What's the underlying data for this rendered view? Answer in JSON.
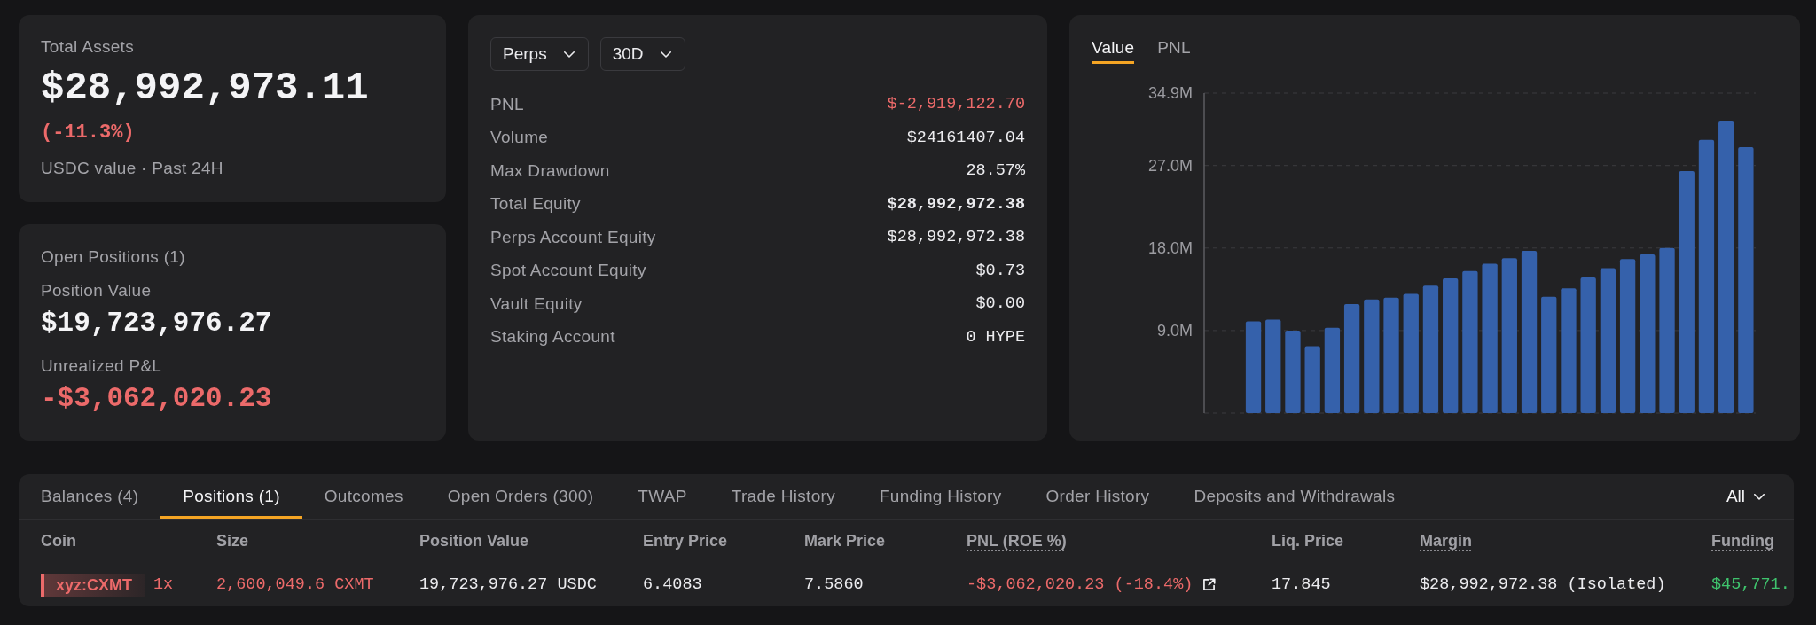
{
  "total_assets": {
    "label": "Total Assets",
    "value": "$28,992,973.11",
    "change": "(-11.3%)",
    "change_negative": true,
    "note": "USDC value · Past 24H"
  },
  "open_positions": {
    "title": "Open Positions (1)",
    "position_value_label": "Position Value",
    "position_value": "$19,723,976.27",
    "unrealized_pnl_label": "Unrealized P&L",
    "unrealized_pnl": "-$3,062,020.23",
    "unrealized_pnl_negative": true
  },
  "summary": {
    "filters": [
      {
        "label": "Perps"
      },
      {
        "label": "30D"
      }
    ],
    "rows": [
      {
        "label": "PNL",
        "value": "$-2,919,122.70",
        "negative": true,
        "bold": false
      },
      {
        "label": "Volume",
        "value": "$24161407.04",
        "negative": false,
        "bold": false
      },
      {
        "label": "Max Drawdown",
        "value": "28.57%",
        "negative": false,
        "bold": false
      },
      {
        "label": "Total Equity",
        "value": "$28,992,972.38",
        "negative": false,
        "bold": true
      },
      {
        "label": "Perps Account Equity",
        "value": "$28,992,972.38",
        "negative": false,
        "bold": false
      },
      {
        "label": "Spot Account Equity",
        "value": "$0.73",
        "negative": false,
        "bold": false
      },
      {
        "label": "Vault Equity",
        "value": "$0.00",
        "negative": false,
        "bold": false
      },
      {
        "label": "Staking Account",
        "value": "0 HYPE",
        "negative": false,
        "bold": false
      }
    ]
  },
  "chart": {
    "tabs": [
      {
        "label": "Value",
        "selected": true
      },
      {
        "label": "PNL",
        "selected": false
      }
    ],
    "chart_data": {
      "type": "bar",
      "grid": true,
      "ylim": [
        0,
        34.9
      ],
      "yticks": [
        {
          "value": 9,
          "label": "9.0M"
        },
        {
          "value": 18,
          "label": "18.0M"
        },
        {
          "value": 27,
          "label": "27.0M"
        },
        {
          "value": 34.9,
          "label": "34.9M"
        }
      ],
      "values": [
        null,
        null,
        10.0,
        10.2,
        9.0,
        7.3,
        9.3,
        11.9,
        12.4,
        12.6,
        13.0,
        13.9,
        14.7,
        15.5,
        16.3,
        16.9,
        17.7,
        12.7,
        13.6,
        14.8,
        15.8,
        16.8,
        17.3,
        18.0,
        26.4,
        29.8,
        31.8,
        29.0
      ]
    }
  },
  "positions": {
    "tabs": [
      {
        "label": "Balances (4)",
        "selected": false
      },
      {
        "label": "Positions (1)",
        "selected": true
      },
      {
        "label": "Outcomes",
        "selected": false
      },
      {
        "label": "Open Orders (300)",
        "selected": false
      },
      {
        "label": "TWAP",
        "selected": false
      },
      {
        "label": "Trade History",
        "selected": false
      },
      {
        "label": "Funding History",
        "selected": false
      },
      {
        "label": "Order History",
        "selected": false
      },
      {
        "label": "Deposits and Withdrawals",
        "selected": false
      }
    ],
    "filter": {
      "label": "All"
    },
    "columns": [
      {
        "label": "Coin",
        "kind": "coin",
        "underlined": false
      },
      {
        "label": "Size",
        "kind": "text",
        "underlined": false
      },
      {
        "label": "Position Value",
        "kind": "text",
        "underlined": false
      },
      {
        "label": "Entry Price",
        "kind": "text",
        "underlined": false
      },
      {
        "label": "Mark Price",
        "kind": "text",
        "underlined": false
      },
      {
        "label": "PNL (ROE %)",
        "kind": "text",
        "underlined": true
      },
      {
        "label": "Liq. Price",
        "kind": "text",
        "underlined": false
      },
      {
        "label": "Margin",
        "kind": "text",
        "underlined": true
      },
      {
        "label": "Funding",
        "kind": "text",
        "underlined": true
      }
    ],
    "rows": [
      {
        "cells": [
          {
            "text": "xyz:CXMT",
            "leverage": "1x",
            "color": "#ec6a6a"
          },
          {
            "text": "2,600,049.6 CXMT",
            "color": "#ec6a6a"
          },
          {
            "text": "19,723,976.27 USDC",
            "color": "#ececef"
          },
          {
            "text": "6.4083",
            "color": "#ececef"
          },
          {
            "text": "7.5860",
            "color": "#ececef"
          },
          {
            "text": "-$3,062,020.23 (-18.4%)",
            "color": "#ec6a6a",
            "link": true
          },
          {
            "text": "17.845",
            "color": "#ececef"
          },
          {
            "text": "$28,992,972.38 (Isolated)",
            "color": "#ececef"
          },
          {
            "text": "$45,771.",
            "color": "#3fc46d"
          }
        ]
      }
    ]
  }
}
